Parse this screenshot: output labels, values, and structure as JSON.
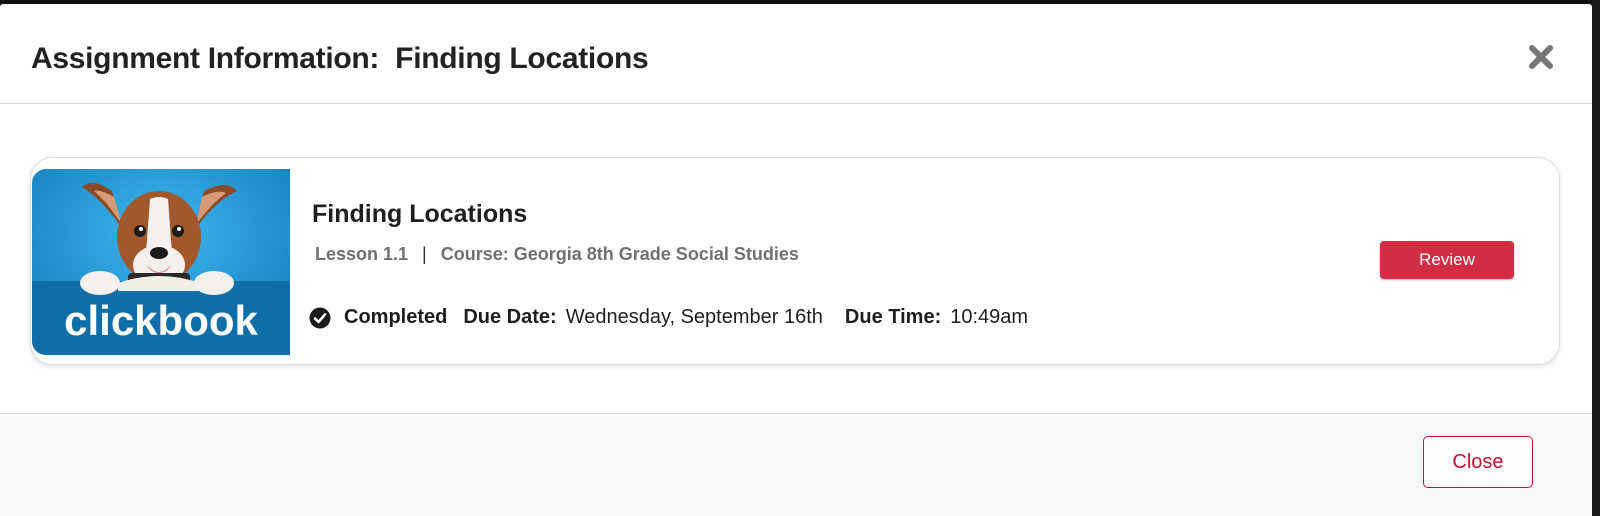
{
  "modal": {
    "title": "Assignment Information:  Finding Locations",
    "close_icon": "close-x-icon"
  },
  "assignment": {
    "thumbnail_brand": "clickbook",
    "title": "Finding Locations",
    "lesson": "Lesson 1.1",
    "separator": "|",
    "course_label": "Course:",
    "course_value": "Georgia 8th Grade Social Studies",
    "status_icon": "check-circle-icon",
    "status": "Completed",
    "due_date_label": "Due Date:",
    "due_date_value": "Wednesday, September 16th",
    "due_time_label": "Due Time:",
    "due_time_value": "10:49am",
    "review_label": "Review"
  },
  "footer": {
    "close_label": "Close"
  },
  "colors": {
    "accent_red": "#d22d45",
    "close_red": "#c8102e",
    "thumbnail_blue": "#1b8fd0"
  }
}
